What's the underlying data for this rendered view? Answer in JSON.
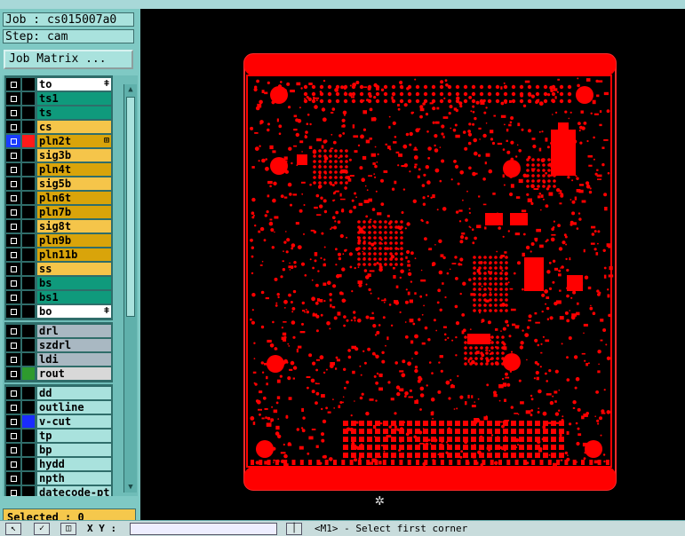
{
  "window": {
    "job_line": "Job : cs015007a0",
    "step_line": "Step: cam",
    "job_matrix_label": "Job Matrix ...",
    "selected_label": "Selected : 0"
  },
  "layer_groups": [
    [
      {
        "name": "to",
        "bg": "#ffffff",
        "swatch": "#000000",
        "mark": "ǂ"
      },
      {
        "name": "ts1",
        "bg": "#0f9a7c",
        "swatch": "#000000",
        "mark": ""
      },
      {
        "name": "ts",
        "bg": "#0f9a7c",
        "swatch": "#000000",
        "mark": ""
      },
      {
        "name": "cs",
        "bg": "#f5c54a",
        "swatch": "#000000",
        "mark": ""
      },
      {
        "name": "pln2t",
        "bg": "#d9a40a",
        "swatch": "#ff1a1a",
        "mark": "⊞",
        "checked_fill": "#1a3cff"
      },
      {
        "name": "sig3b",
        "bg": "#f5c54a",
        "swatch": "#000000",
        "mark": ""
      },
      {
        "name": "pln4t",
        "bg": "#d9a40a",
        "swatch": "#000000",
        "mark": ""
      },
      {
        "name": "sig5b",
        "bg": "#f5c54a",
        "swatch": "#000000",
        "mark": ""
      },
      {
        "name": "pln6t",
        "bg": "#d9a40a",
        "swatch": "#000000",
        "mark": ""
      },
      {
        "name": "pln7b",
        "bg": "#d9a40a",
        "swatch": "#000000",
        "mark": ""
      },
      {
        "name": "sig8t",
        "bg": "#f5c54a",
        "swatch": "#000000",
        "mark": ""
      },
      {
        "name": "pln9b",
        "bg": "#d9a40a",
        "swatch": "#000000",
        "mark": ""
      },
      {
        "name": "pln11b",
        "bg": "#d9a40a",
        "swatch": "#000000",
        "mark": ""
      },
      {
        "name": "ss",
        "bg": "#f5c54a",
        "swatch": "#000000",
        "mark": ""
      },
      {
        "name": "bs",
        "bg": "#0f9a7c",
        "swatch": "#000000",
        "mark": ""
      },
      {
        "name": "bs1",
        "bg": "#0f9a7c",
        "swatch": "#000000",
        "mark": ""
      },
      {
        "name": "bo",
        "bg": "#ffffff",
        "swatch": "#000000",
        "mark": "ǂ"
      }
    ],
    [
      {
        "name": "drl",
        "bg": "#a9b8c2",
        "swatch": "#000000",
        "mark": ""
      },
      {
        "name": "szdrl",
        "bg": "#a9b8c2",
        "swatch": "#000000",
        "mark": ""
      },
      {
        "name": "ldi",
        "bg": "#a9b8c2",
        "swatch": "#000000",
        "mark": ""
      },
      {
        "name": "rout",
        "bg": "#d8d8d8",
        "swatch": "#2e9a2e",
        "mark": ""
      }
    ],
    [
      {
        "name": "dd",
        "bg": "#a9e2dd",
        "swatch": "#000000",
        "mark": ""
      },
      {
        "name": "outline",
        "bg": "#a9e2dd",
        "swatch": "#000000",
        "mark": ""
      },
      {
        "name": "v-cut",
        "bg": "#a9e2dd",
        "swatch": "#1a2cff",
        "mark": ""
      },
      {
        "name": "tp",
        "bg": "#a9e2dd",
        "swatch": "#000000",
        "mark": ""
      },
      {
        "name": "bp",
        "bg": "#a9e2dd",
        "swatch": "#000000",
        "mark": ""
      },
      {
        "name": "hydd",
        "bg": "#a9e2dd",
        "swatch": "#000000",
        "mark": ""
      },
      {
        "name": "npth",
        "bg": "#a9e2dd",
        "swatch": "#000000",
        "mark": ""
      },
      {
        "name": "datecode-pt",
        "bg": "#a9e2dd",
        "swatch": "#000000",
        "mark": ""
      }
    ]
  ],
  "bottom": {
    "xy_label": "X Y :",
    "prompt": "<M1> - Select first corner",
    "btn_select_glyph": "↖",
    "btn_check_glyph": "✓",
    "btn_window_glyph": "◫",
    "btn_bar_glyph": "│"
  },
  "colors": {
    "copper": "#ff0000",
    "canvas_bg": "#000000",
    "panel_bg": "#7fc9c4"
  },
  "icons": {
    "cursor": "crosshair-cursor-icon"
  }
}
